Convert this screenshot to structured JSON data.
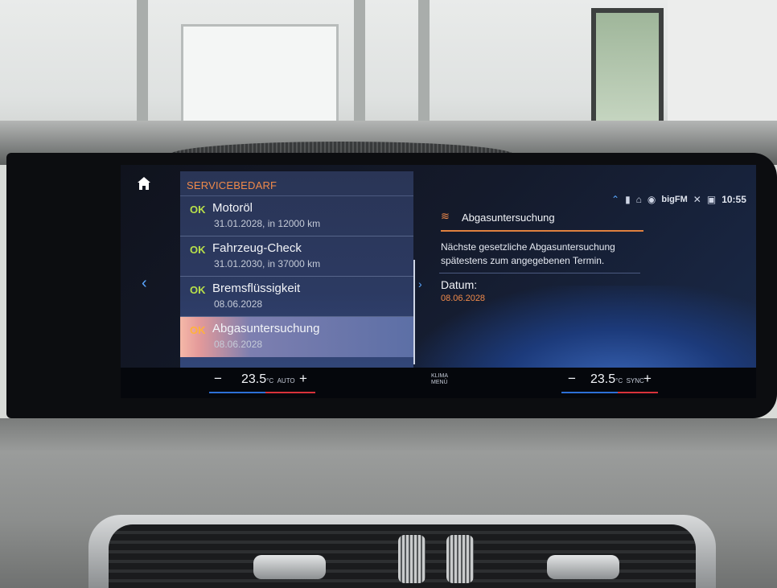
{
  "screen": {
    "list": {
      "title": "SERVICEBEDARF",
      "items": [
        {
          "status": "OK",
          "name": "Motoröl",
          "sub": "31.01.2028, in 12000 km",
          "selected": false
        },
        {
          "status": "OK",
          "name": "Fahrzeug-Check",
          "sub": "31.01.2030, in 37000 km",
          "selected": false
        },
        {
          "status": "OK",
          "name": "Bremsflüssigkeit",
          "sub": "08.06.2028",
          "selected": false
        },
        {
          "status": "OK",
          "name": "Abgasuntersuchung",
          "sub": "08.06.2028",
          "selected": true
        }
      ]
    },
    "detail": {
      "title": "Abgasuntersuchung",
      "description": "Nächste gesetzliche Abgasuntersuchung spätestens zum angegebenen Termin.",
      "date_label": "Datum:",
      "date_value": "08.06.2028"
    },
    "status_bar": {
      "radio": "bigFM",
      "time": "10:55"
    },
    "climate": {
      "left_minus": "−",
      "left_temp": "23.5",
      "left_unit": "°C",
      "left_mode": "AUTO",
      "left_plus": "+",
      "menu_line1": "KLIMA",
      "menu_line2": "MENÜ",
      "right_minus": "−",
      "right_temp": "23.5",
      "right_unit": "°C",
      "right_mode": "SYNC",
      "right_plus": "+"
    }
  },
  "colors": {
    "accent_orange": "#f08a4a",
    "ok_green": "#b8e04a",
    "ok_selected": "#ffb23a",
    "nav_blue": "#5aa7ff"
  }
}
